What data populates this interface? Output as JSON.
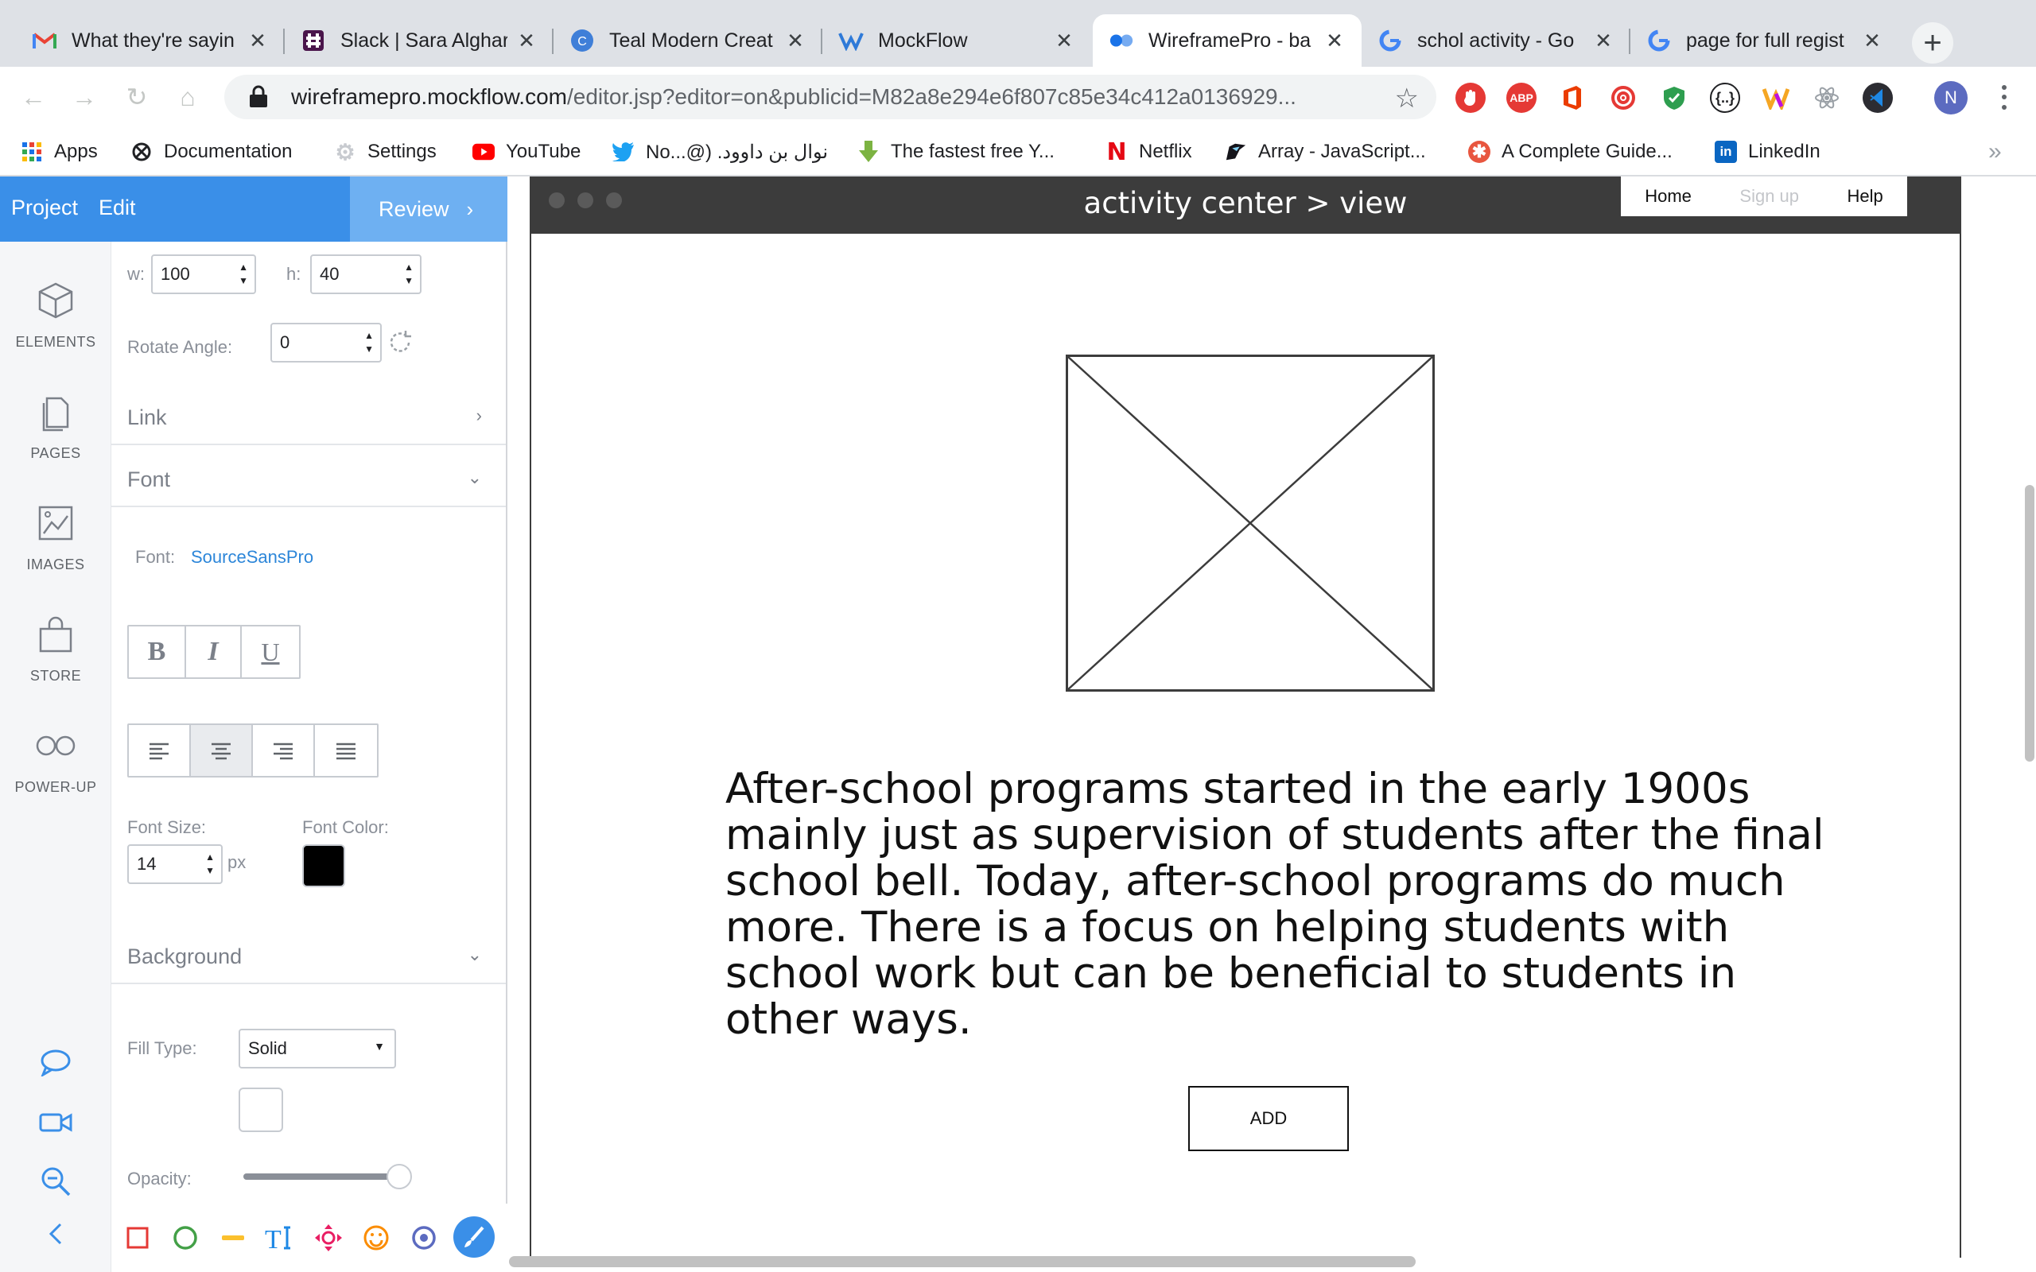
{
  "browser": {
    "tabs": [
      {
        "title": "What they're sayin",
        "favicon": "gmail-icon"
      },
      {
        "title": "Slack | Sara Alghar",
        "favicon": "slack-icon"
      },
      {
        "title": "Teal Modern Creat",
        "favicon": "canva-icon"
      },
      {
        "title": "MockFlow",
        "favicon": "mockflow-icon"
      },
      {
        "title": "WireframePro - ba",
        "favicon": "wireframepro-icon",
        "active": true
      },
      {
        "title": "schol activity - Go",
        "favicon": "google-icon"
      },
      {
        "title": "page for full regist",
        "favicon": "google-icon"
      }
    ],
    "url_host": "wireframepro.mockflow.com",
    "url_path": "/editor.jsp?editor=on&publicid=M82a8e294e6f807c85e34c412a0136929...",
    "profile_initial": "N",
    "extension_abp_label": "ABP",
    "bookmarks": [
      {
        "label": "Apps",
        "icon": "apps-grid-icon"
      },
      {
        "label": "Documentation",
        "icon": "gear-outline-icon"
      },
      {
        "label": "Settings",
        "icon": "gear-icon"
      },
      {
        "label": "YouTube",
        "icon": "youtube-icon"
      },
      {
        "label": "No...@) .نوال بن داوود",
        "icon": "twitter-icon"
      },
      {
        "label": "The fastest free Y...",
        "icon": "download-arrow-icon"
      },
      {
        "label": "Netflix",
        "icon": "netflix-icon"
      },
      {
        "label": "Array - JavaScript...",
        "icon": "mdn-icon"
      },
      {
        "label": "A Complete Guide...",
        "icon": "css-tricks-icon"
      },
      {
        "label": "LinkedIn",
        "icon": "linkedin-icon"
      }
    ],
    "bookmarks_more": "»"
  },
  "editor": {
    "menu": {
      "project": "Project",
      "edit": "Edit",
      "review": "Review",
      "review_arrow": "›"
    },
    "sidebar": [
      {
        "label": "ELEMENTS",
        "icon": "cube-icon"
      },
      {
        "label": "PAGES",
        "icon": "pages-icon"
      },
      {
        "label": "IMAGES",
        "icon": "image-icon"
      },
      {
        "label": "STORE",
        "icon": "shopping-bag-icon"
      },
      {
        "label": "POWER-UP",
        "icon": "infinity-icon"
      }
    ],
    "properties": {
      "w_label": "w:",
      "w_value": "100",
      "h_label": "h:",
      "h_value": "40",
      "rotate_label": "Rotate Angle:",
      "rotate_value": "0",
      "link_section": "Link",
      "font_section": "Font",
      "font_label": "Font:",
      "font_value": "SourceSansPro",
      "bold": "B",
      "italic": "I",
      "underline": "U",
      "alignment_selected": "center",
      "font_size_label": "Font Size:",
      "font_size_value": "14",
      "font_size_unit": "px",
      "font_color_label": "Font Color:",
      "font_color": "#000000",
      "background_section": "Background",
      "fill_type_label": "Fill Type:",
      "fill_type_value": "Solid",
      "fill_color": "#ffffff",
      "opacity_label": "Opacity:",
      "opacity_value": 1.0
    },
    "bottom_tools": [
      "rectangle-icon",
      "circle-icon",
      "line-icon",
      "text-tool-icon",
      "move-icon",
      "emoji-icon",
      "radio-icon",
      "brush-icon"
    ],
    "colors": {
      "accent": "#3a8fe8",
      "review": "#6eb0f2"
    }
  },
  "mockup": {
    "title": "activity center > view",
    "nav": {
      "home": "Home",
      "signup": "Sign up",
      "help": "Help"
    },
    "body_text": "After-school programs started in the early 1900s mainly just as supervision of students after the final school bell. Today, after-school programs do much more. There is a focus on helping students with school work but can be beneficial to students in other ways.",
    "add_button": "ADD"
  }
}
